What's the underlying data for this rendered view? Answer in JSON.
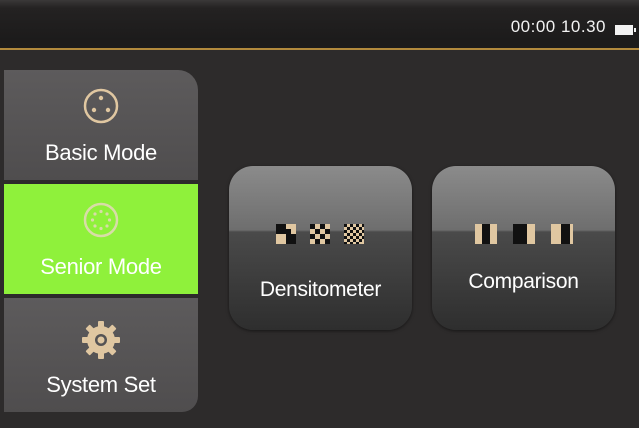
{
  "status_bar": {
    "time": "00:00 10.30",
    "battery_icon": "battery-full-icon"
  },
  "sidebar": {
    "items": [
      {
        "label": "Basic Mode",
        "icon": "basic-mode-icon",
        "active": false
      },
      {
        "label": "Senior Mode",
        "icon": "senior-mode-icon",
        "active": true
      },
      {
        "label": "System Set",
        "icon": "gear-icon",
        "active": false
      }
    ]
  },
  "main": {
    "cards": [
      {
        "label": "Densitometer",
        "icon": "densitometer-icon"
      },
      {
        "label": "Comparison",
        "icon": "comparison-icon"
      }
    ]
  },
  "colors": {
    "background": "#2d2b2b",
    "active_tab": "#8ff13b",
    "status_line": "#b28a3d",
    "icon_tan": "#e0c7a1"
  }
}
